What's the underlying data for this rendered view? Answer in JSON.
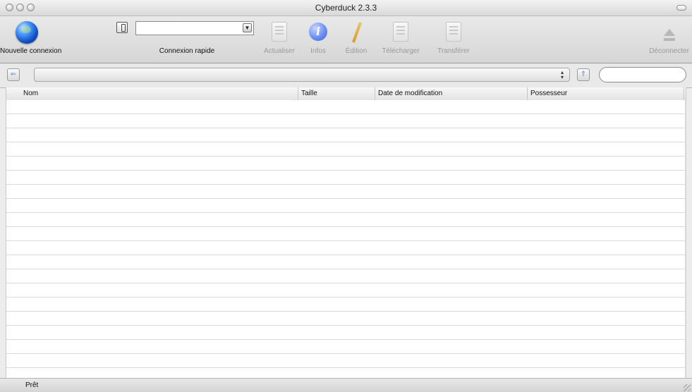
{
  "window": {
    "title": "Cyberduck 2.3.3"
  },
  "toolbar": {
    "new_connection": {
      "label": "Nouvelle connexion",
      "icon": "globe-icon"
    },
    "quick_connect": {
      "label": "Connexion rapide",
      "value": ""
    },
    "refresh": {
      "label": "Actualiser",
      "enabled": false
    },
    "info": {
      "label": "Infos",
      "enabled": true
    },
    "edit": {
      "label": "Édition",
      "enabled": false
    },
    "download": {
      "label": "Télécharger",
      "enabled": false
    },
    "upload": {
      "label": "Transférer",
      "enabled": false
    },
    "disconnect": {
      "label": "Déconnecter",
      "enabled": false
    }
  },
  "pathbar": {
    "path_value": "",
    "search_value": ""
  },
  "table": {
    "columns": [
      "Nom",
      "Taille",
      "Date de modification",
      "Possesseur"
    ],
    "rows": []
  },
  "status": {
    "text": "Prêt"
  },
  "colors": {
    "accent": "#3b5fcf",
    "window_bg": "#ececec"
  }
}
